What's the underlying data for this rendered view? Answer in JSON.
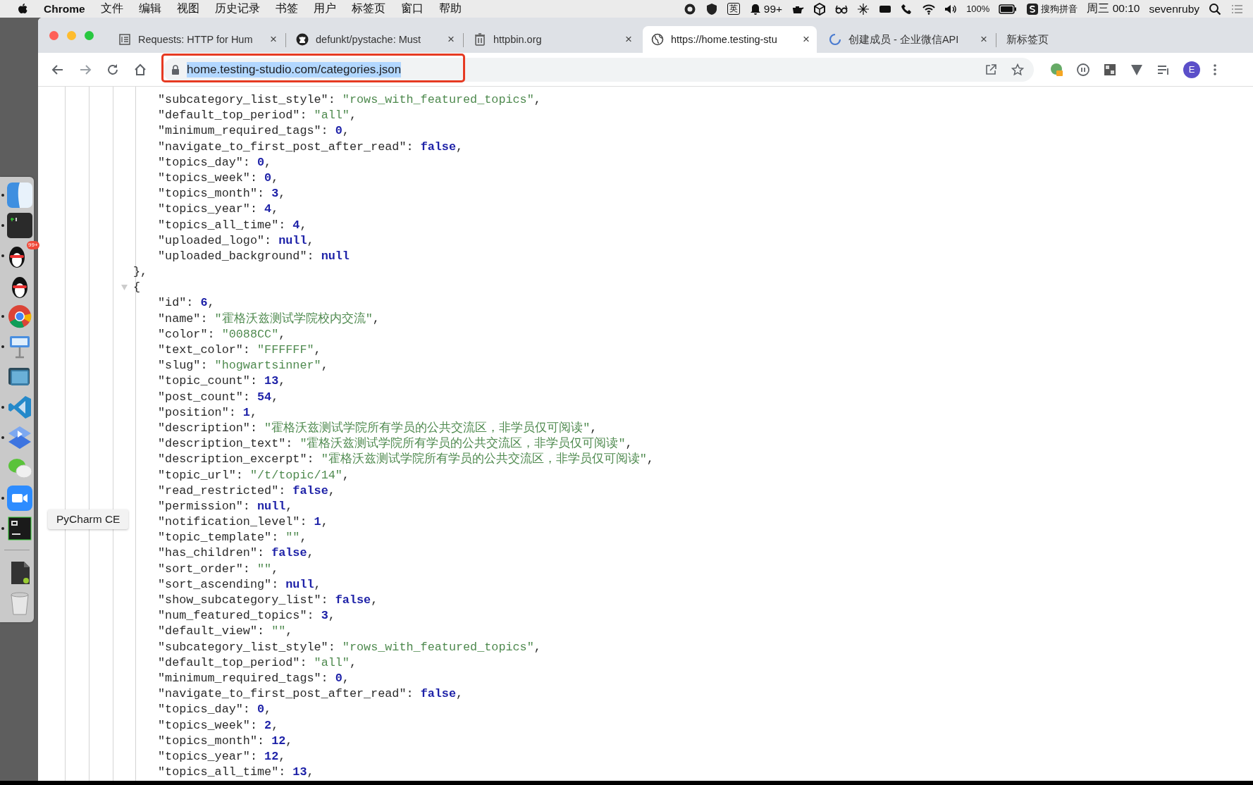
{
  "menu_bar": {
    "app": "Chrome",
    "menus": [
      "文件",
      "编辑",
      "视图",
      "历史记录",
      "书签",
      "用户",
      "标签页",
      "窗口",
      "帮助"
    ],
    "ime": "英",
    "notifications": "99+",
    "battery": "100%",
    "input_method": "搜狗拼音",
    "clock": "周三 00:10",
    "user": "sevenruby"
  },
  "dock": [
    {
      "running": true
    },
    {
      "running": true
    },
    {
      "running": true,
      "badge": "99+"
    },
    {
      "running": false
    },
    {
      "running": true
    },
    {
      "running": true
    },
    {
      "running": false
    },
    {
      "running": true
    },
    {
      "running": true
    },
    {
      "running": false
    },
    {
      "running": true
    },
    {
      "running": true
    },
    {
      "running": false
    },
    {
      "running": false
    }
  ],
  "tooltip": "PyCharm CE",
  "tabs": [
    {
      "title": "Requests: HTTP for Hum",
      "selected": false,
      "close": "×"
    },
    {
      "title": "defunkt/pystache: Must",
      "selected": false,
      "close": "×"
    },
    {
      "title": "httpbin.org",
      "selected": false,
      "close": "×"
    },
    {
      "title": "https://home.testing-stu",
      "selected": true,
      "close": "×"
    },
    {
      "title": "创建成员 - 企业微信API",
      "selected": false,
      "close": "×"
    },
    {
      "title": "新标签页",
      "selected": false
    }
  ],
  "address_bar": {
    "url": "home.testing-studio.com/categories.json",
    "url_selected": true,
    "highlighted": true,
    "avatar": "E"
  },
  "json_lines": [
    {
      "kind": "string",
      "key": "\"subcategory_list_style\":",
      "value": "\"rows_with_featured_topics\"",
      "tail": ","
    },
    {
      "kind": "string",
      "key": "\"default_top_period\":",
      "value": "\"all\"",
      "tail": ","
    },
    {
      "kind": "number",
      "key": "\"minimum_required_tags\":",
      "value": "0",
      "tail": ","
    },
    {
      "kind": "boolean",
      "key": "\"navigate_to_first_post_after_read\":",
      "value": "false",
      "tail": ","
    },
    {
      "kind": "number",
      "key": "\"topics_day\":",
      "value": "0",
      "tail": ","
    },
    {
      "kind": "number",
      "key": "\"topics_week\":",
      "value": "0",
      "tail": ","
    },
    {
      "kind": "number",
      "key": "\"topics_month\":",
      "value": "3",
      "tail": ","
    },
    {
      "kind": "number",
      "key": "\"topics_year\":",
      "value": "4",
      "tail": ","
    },
    {
      "kind": "number",
      "key": "\"topics_all_time\":",
      "value": "4",
      "tail": ","
    },
    {
      "kind": "null",
      "key": "\"uploaded_logo\":",
      "value": "null",
      "tail": ","
    },
    {
      "kind": "null",
      "key": "\"uploaded_background\":",
      "value": "null"
    },
    {
      "kind": "close",
      "text": "},"
    },
    {
      "kind": "open",
      "text": "{",
      "expanded": true
    },
    {
      "kind": "number",
      "key": "\"id\":",
      "value": "6",
      "tail": ","
    },
    {
      "kind": "string",
      "key": "\"name\":",
      "value": "\"霍格沃兹测试学院校内交流\"",
      "tail": ","
    },
    {
      "kind": "string",
      "key": "\"color\":",
      "value": "\"0088CC\"",
      "tail": ","
    },
    {
      "kind": "string",
      "key": "\"text_color\":",
      "value": "\"FFFFFF\"",
      "tail": ","
    },
    {
      "kind": "string",
      "key": "\"slug\":",
      "value": "\"hogwartsinner\"",
      "tail": ","
    },
    {
      "kind": "number",
      "key": "\"topic_count\":",
      "value": "13",
      "tail": ","
    },
    {
      "kind": "number",
      "key": "\"post_count\":",
      "value": "54",
      "tail": ","
    },
    {
      "kind": "number",
      "key": "\"position\":",
      "value": "1",
      "tail": ","
    },
    {
      "kind": "string",
      "key": "\"description\":",
      "value": "\"霍格沃兹测试学院所有学员的公共交流区，非学员仅可阅读\"",
      "tail": ","
    },
    {
      "kind": "string",
      "key": "\"description_text\":",
      "value": "\"霍格沃兹测试学院所有学员的公共交流区，非学员仅可阅读\"",
      "tail": ","
    },
    {
      "kind": "string",
      "key": "\"description_excerpt\":",
      "value": "\"霍格沃兹测试学院所有学员的公共交流区，非学员仅可阅读\"",
      "tail": ","
    },
    {
      "kind": "string",
      "key": "\"topic_url\":",
      "value": "\"/t/topic/14\"",
      "tail": ","
    },
    {
      "kind": "boolean",
      "key": "\"read_restricted\":",
      "value": "false",
      "tail": ","
    },
    {
      "kind": "null",
      "key": "\"permission\":",
      "value": "null",
      "tail": ","
    },
    {
      "kind": "number",
      "key": "\"notification_level\":",
      "value": "1",
      "tail": ","
    },
    {
      "kind": "string",
      "key": "\"topic_template\":",
      "value": "\"\"",
      "tail": ","
    },
    {
      "kind": "boolean",
      "key": "\"has_children\":",
      "value": "false",
      "tail": ","
    },
    {
      "kind": "string",
      "key": "\"sort_order\":",
      "value": "\"\"",
      "tail": ","
    },
    {
      "kind": "null",
      "key": "\"sort_ascending\":",
      "value": "null",
      "tail": ","
    },
    {
      "kind": "boolean",
      "key": "\"show_subcategory_list\":",
      "value": "false",
      "tail": ","
    },
    {
      "kind": "number",
      "key": "\"num_featured_topics\":",
      "value": "3",
      "tail": ","
    },
    {
      "kind": "string",
      "key": "\"default_view\":",
      "value": "\"\"",
      "tail": ","
    },
    {
      "kind": "string",
      "key": "\"subcategory_list_style\":",
      "value": "\"rows_with_featured_topics\"",
      "tail": ","
    },
    {
      "kind": "string",
      "key": "\"default_top_period\":",
      "value": "\"all\"",
      "tail": ","
    },
    {
      "kind": "number",
      "key": "\"minimum_required_tags\":",
      "value": "0",
      "tail": ","
    },
    {
      "kind": "boolean",
      "key": "\"navigate_to_first_post_after_read\":",
      "value": "false",
      "tail": ","
    },
    {
      "kind": "number",
      "key": "\"topics_day\":",
      "value": "0",
      "tail": ","
    },
    {
      "kind": "number",
      "key": "\"topics_week\":",
      "value": "2",
      "tail": ","
    },
    {
      "kind": "number",
      "key": "\"topics_month\":",
      "value": "12",
      "tail": ","
    },
    {
      "kind": "number",
      "key": "\"topics_year\":",
      "value": "12",
      "tail": ","
    },
    {
      "kind": "number",
      "key": "\"topics_all_time\":",
      "value": "13",
      "tail": ","
    }
  ]
}
